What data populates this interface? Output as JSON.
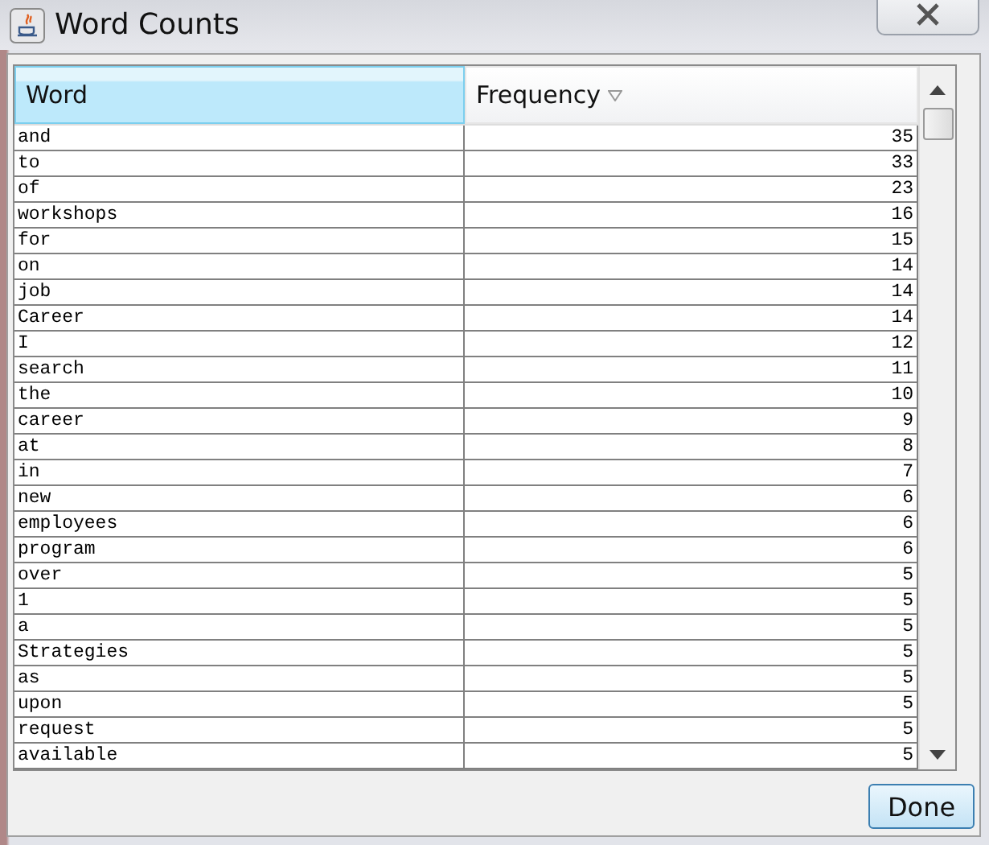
{
  "window": {
    "title": "Word Counts"
  },
  "table": {
    "columns": [
      {
        "label": "Word",
        "selected": true,
        "sorted": false
      },
      {
        "label": "Frequency",
        "selected": false,
        "sorted": true
      }
    ],
    "rows": [
      {
        "word": "and",
        "frequency": "35"
      },
      {
        "word": "to",
        "frequency": "33"
      },
      {
        "word": "of",
        "frequency": "23"
      },
      {
        "word": "workshops",
        "frequency": "16"
      },
      {
        "word": "for",
        "frequency": "15"
      },
      {
        "word": "on",
        "frequency": "14"
      },
      {
        "word": "job",
        "frequency": "14"
      },
      {
        "word": "Career",
        "frequency": "14"
      },
      {
        "word": "I",
        "frequency": "12"
      },
      {
        "word": "search",
        "frequency": "11"
      },
      {
        "word": "the",
        "frequency": "10"
      },
      {
        "word": "career",
        "frequency": "9"
      },
      {
        "word": "at",
        "frequency": "8"
      },
      {
        "word": "in",
        "frequency": "7"
      },
      {
        "word": "new",
        "frequency": "6"
      },
      {
        "word": "employees",
        "frequency": "6"
      },
      {
        "word": "program",
        "frequency": "6"
      },
      {
        "word": "over",
        "frequency": "5"
      },
      {
        "word": "1",
        "frequency": "5"
      },
      {
        "word": "a",
        "frequency": "5"
      },
      {
        "word": "Strategies",
        "frequency": "5"
      },
      {
        "word": "as",
        "frequency": "5"
      },
      {
        "word": "upon",
        "frequency": "5"
      },
      {
        "word": "request",
        "frequency": "5"
      },
      {
        "word": "available",
        "frequency": "5"
      }
    ]
  },
  "buttons": [
    {
      "label": "Done"
    }
  ]
}
